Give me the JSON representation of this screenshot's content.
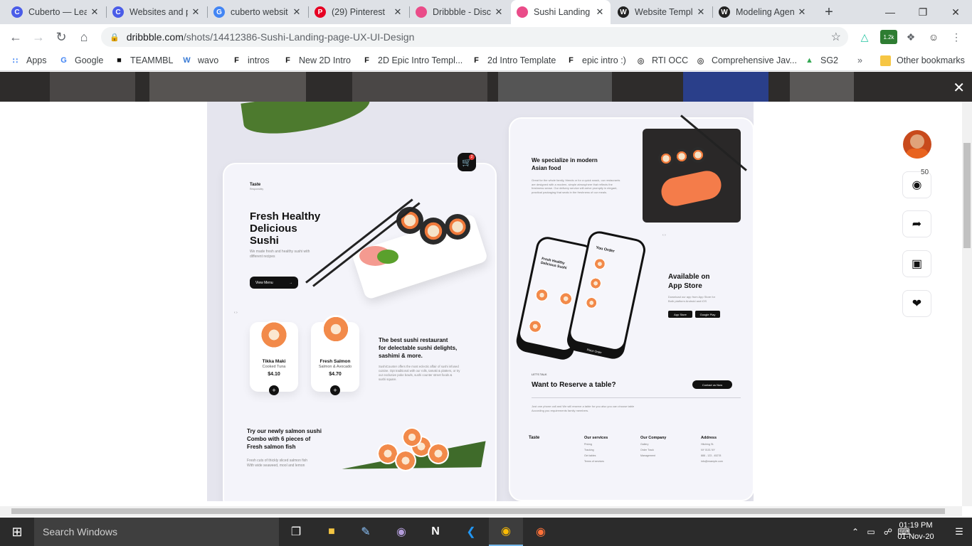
{
  "tabs": [
    {
      "title": "Cuberto — Lea",
      "icon": "cuberto-icon",
      "color": "#4a5ce8",
      "glyph": "C"
    },
    {
      "title": "Websites and p",
      "icon": "cuberto-icon",
      "color": "#4a5ce8",
      "glyph": "C"
    },
    {
      "title": "cuberto websit",
      "icon": "google-icon",
      "color": "#4285f4",
      "glyph": "G"
    },
    {
      "title": "(29) Pinterest",
      "icon": "pinterest-icon",
      "color": "#e60023",
      "glyph": "P"
    },
    {
      "title": "Dribbble - Disc",
      "icon": "dribbble-icon",
      "color": "#ea4c89",
      "glyph": ""
    },
    {
      "title": "Sushi Landing",
      "icon": "dribbble-icon",
      "color": "#ea4c89",
      "glyph": ""
    },
    {
      "title": "Website Templ",
      "icon": "wix-icon",
      "color": "#222222",
      "glyph": "W"
    },
    {
      "title": "Modeling Agen",
      "icon": "wix-icon",
      "color": "#222222",
      "glyph": "W"
    }
  ],
  "address": {
    "domain": "dribbble.com",
    "path": "/shots/14412386-Sushi-Landing-page-UX-UI-Design"
  },
  "extensions": {
    "badge": "1.2k"
  },
  "bookmarks": [
    {
      "label": "Apps",
      "icon": "apps-grid-icon"
    },
    {
      "label": "Google",
      "icon": "google-icon"
    },
    {
      "label": "TEAMMBL",
      "icon": "teammbl-icon"
    },
    {
      "label": "wavo",
      "icon": "wavo-icon"
    },
    {
      "label": "intros",
      "icon": "flag-icon"
    },
    {
      "label": "New 2D Intro",
      "icon": "flag-icon"
    },
    {
      "label": "2D Epic Intro Templ...",
      "icon": "flag-icon"
    },
    {
      "label": "2d Intro Template",
      "icon": "flag-icon"
    },
    {
      "label": "epic intro :)",
      "icon": "flag-icon"
    },
    {
      "label": "RTI OCC",
      "icon": "globe-icon"
    },
    {
      "label": "Comprehensive Jav...",
      "icon": "globe-icon"
    },
    {
      "label": "SG2",
      "icon": "drive-icon"
    }
  ],
  "other_bookmarks": "Other bookmarks",
  "design": {
    "brand": "Taste",
    "brand_sub": "Responsibly",
    "hero_title": [
      "Fresh Healthy",
      "Delicious",
      "Sushi"
    ],
    "hero_desc": [
      "We made fresh and healthy sushi with",
      "different recipes"
    ],
    "view_menu": "View Menu",
    "cart_count": "2",
    "items": [
      {
        "name": "Tikka Maki",
        "sub": "Cooked Tuna",
        "price": "$4.10"
      },
      {
        "name": "Fresh Salmon",
        "sub": "Salmon & Avocado",
        "price": "$4.70"
      }
    ],
    "best_title": [
      "The best sushi restaurant",
      "for delectable sushi delights,",
      "sashimi & more."
    ],
    "best_desc": [
      "SushiCounter offers the most eclectic affair of sushi infused",
      "cuisine. Opt traditional with our rolls, tamaki & platters, or try",
      "our exclusive poke bowls, sushi counter street foods &",
      "sushi square."
    ],
    "combo_title": [
      "Try our newly salmon sushi",
      "Combo with 6 pieces of",
      "Fresh salmon fish"
    ],
    "combo_desc": [
      "Fresh cuts of thickly sliced salmon fish",
      "With wide seaweed, mool and lemon"
    ],
    "special_title": [
      "We specialize in modern",
      "Asian food"
    ],
    "special_desc": [
      "Great for the whole family, friends or for a quick snack, our restaurants",
      "are designed with a modern, simple atmosphere that reflects the",
      "freshness sense. Our delivery service will arrive promptly in elegant,",
      "practical packaging that seals in the freshness of our meals."
    ],
    "app_title": [
      "Available on",
      "App Store"
    ],
    "app_desc": [
      "Download our app from App Store for",
      "Both platform Android and iOS"
    ],
    "app_store": "App Store",
    "google_play": "Google Play",
    "phone_title": [
      "Fresh Healthy",
      "Delicious Sushi"
    ],
    "phone_order": "You Order",
    "phone_place": "Place Order",
    "lets_talk": "LET'S TALK",
    "reserve_title": "Want to Reserve a table?",
    "contact_btn": "Contact us Now",
    "reserve_desc": [
      "Just one phone call and We will reserve a table for you also you can choose table",
      "According you requirements family members."
    ],
    "footer_brand": "Taste",
    "footer_cols": [
      {
        "title": "Our services",
        "items": [
          "Pricing",
          "Tracking",
          "Get tables",
          "Terms of services"
        ]
      },
      {
        "title": "Our Company",
        "items": [
          "Gallery",
          "Order Track",
          "Management"
        ]
      },
      {
        "title": "Address",
        "items": [
          "Hitching St.",
          "NY 0101 NY",
          "888 - 123 - 45278",
          "info@example.com"
        ]
      }
    ]
  },
  "comments_count": "50",
  "taskbar": {
    "search_placeholder": "Search Windows",
    "time": "01:19 PM",
    "date": "01-Nov-20"
  }
}
